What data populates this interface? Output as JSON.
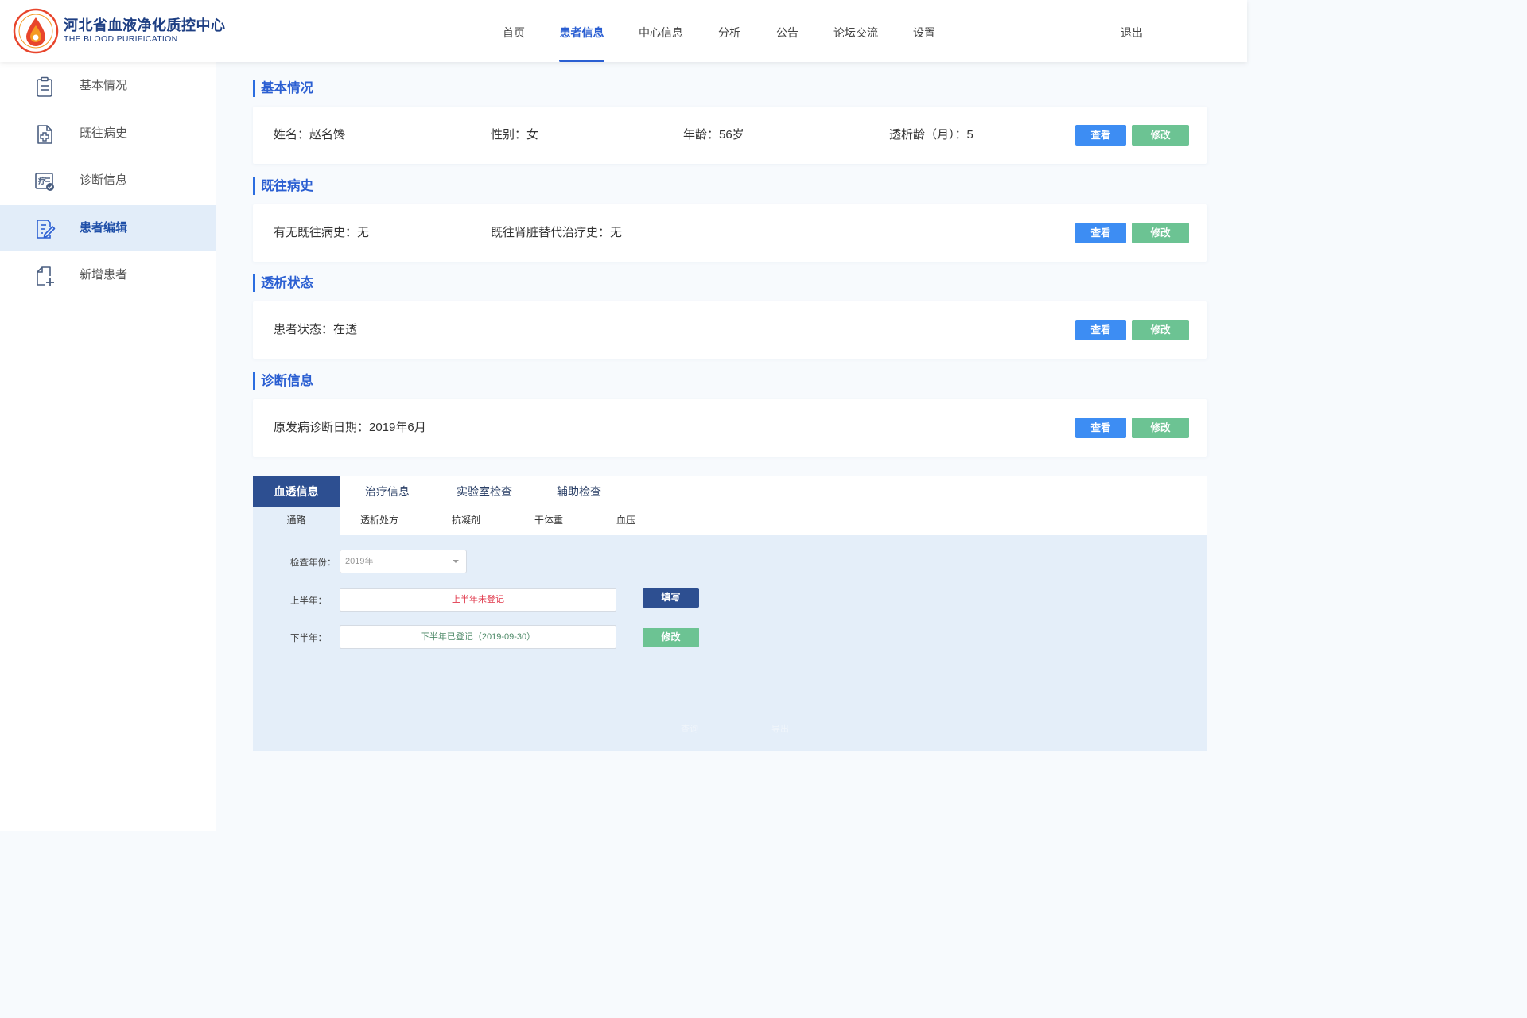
{
  "brand": {
    "title": "河北省血液净化质控中心",
    "subtitle": "THE BLOOD PURIFICATION"
  },
  "nav": {
    "items": [
      "首页",
      "患者信息",
      "中心信息",
      "分析",
      "公告",
      "论坛交流",
      "设置"
    ],
    "active": "患者信息",
    "logout": "退出"
  },
  "sidebar": {
    "items": [
      {
        "label": "基本情况",
        "icon": "clipboard-icon"
      },
      {
        "label": "既往病史",
        "icon": "medical-file-icon"
      },
      {
        "label": "诊断信息",
        "icon": "diagnosis-icon"
      },
      {
        "label": "患者编辑",
        "icon": "edit-document-icon"
      },
      {
        "label": "新增患者",
        "icon": "add-document-icon"
      }
    ],
    "active": "患者编辑"
  },
  "sections": {
    "basic": {
      "title": "基本情况",
      "name": "姓名：赵名馋",
      "gender": "性别：女",
      "age": "年龄：56岁",
      "dialysis_age": "透析龄（月）：5"
    },
    "history": {
      "title": "既往病史",
      "has_history": "有无既往病史：无",
      "renal_history": "既往肾脏替代治疗史：无"
    },
    "status": {
      "title": "透析状态",
      "patient_status": "患者状态：在透"
    },
    "diagnosis": {
      "title": "诊断信息",
      "date": "原发病诊断日期：2019年6月"
    }
  },
  "buttons": {
    "view": "查看",
    "edit": "修改",
    "fill": "填写",
    "modify": "修改"
  },
  "tabs": {
    "main": [
      "血透信息",
      "治疗信息",
      "实验室检查",
      "辅助检查"
    ],
    "active_main": "血透信息",
    "sub": [
      "通路",
      "透析处方",
      "抗凝剂",
      "干体重",
      "血压"
    ],
    "active_sub": "通路"
  },
  "form": {
    "year_label": "检查年份：",
    "year_value": "2019年",
    "first_half_label": "上半年：",
    "first_half_value": "上半年未登记",
    "second_half_label": "下半年：",
    "second_half_value": "下半年已登记（2019-09-30）",
    "query": "查询",
    "export": "导出"
  },
  "colors": {
    "primary": "#2b5fd2",
    "navy": "#2d4f91",
    "view_button": "#3d8df3",
    "edit_button": "#6cc393",
    "alert_text": "#e0374a",
    "logo_red": "#e8452c",
    "logo_orange": "#f59a23"
  }
}
